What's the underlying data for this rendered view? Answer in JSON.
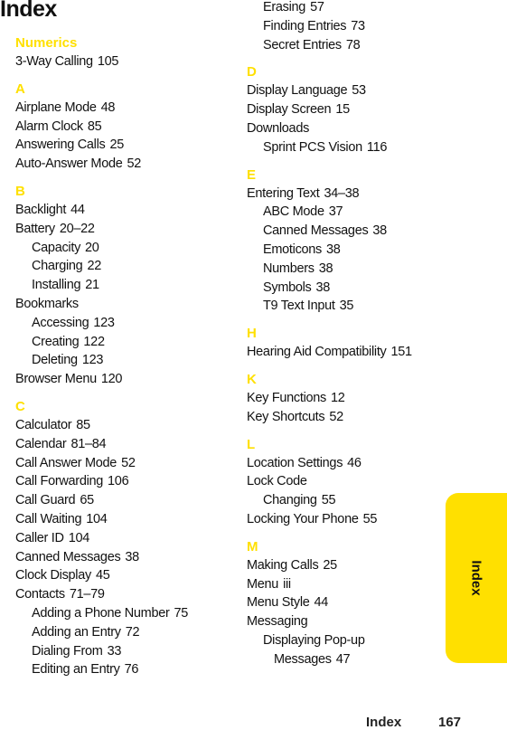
{
  "page": {
    "title": "Index",
    "tab_label": "Index",
    "footer_section": "Index",
    "footer_page": "167",
    "accent_color": "#FFE000"
  },
  "left_column": [
    {
      "letter": "Numerics",
      "entries": [
        {
          "level": 0,
          "text": "3-Way Calling",
          "page": "105"
        }
      ]
    },
    {
      "letter": "A",
      "entries": [
        {
          "level": 0,
          "text": "Airplane Mode",
          "page": "48"
        },
        {
          "level": 0,
          "text": "Alarm Clock",
          "page": "85"
        },
        {
          "level": 0,
          "text": "Answering Calls",
          "page": "25"
        },
        {
          "level": 0,
          "text": "Auto-Answer Mode",
          "page": "52"
        }
      ]
    },
    {
      "letter": "B",
      "entries": [
        {
          "level": 0,
          "text": "Backlight",
          "page": "44"
        },
        {
          "level": 0,
          "text": "Battery",
          "page": "20–22"
        },
        {
          "level": 1,
          "text": "Capacity",
          "page": "20"
        },
        {
          "level": 1,
          "text": "Charging",
          "page": "22"
        },
        {
          "level": 1,
          "text": "Installing",
          "page": "21"
        },
        {
          "level": 0,
          "text": "Bookmarks",
          "page": ""
        },
        {
          "level": 1,
          "text": "Accessing",
          "page": "123"
        },
        {
          "level": 1,
          "text": "Creating",
          "page": "122"
        },
        {
          "level": 1,
          "text": "Deleting",
          "page": "123"
        },
        {
          "level": 0,
          "text": "Browser Menu",
          "page": "120"
        }
      ]
    },
    {
      "letter": "C",
      "entries": [
        {
          "level": 0,
          "text": "Calculator",
          "page": "85"
        },
        {
          "level": 0,
          "text": "Calendar",
          "page": "81–84"
        },
        {
          "level": 0,
          "text": "Call Answer Mode",
          "page": "52"
        },
        {
          "level": 0,
          "text": "Call Forwarding",
          "page": "106"
        },
        {
          "level": 0,
          "text": "Call Guard",
          "page": "65"
        },
        {
          "level": 0,
          "text": "Call Waiting",
          "page": "104"
        },
        {
          "level": 0,
          "text": "Caller ID",
          "page": "104"
        },
        {
          "level": 0,
          "text": "Canned Messages",
          "page": "38"
        },
        {
          "level": 0,
          "text": "Clock Display",
          "page": "45"
        },
        {
          "level": 0,
          "text": "Contacts",
          "page": "71–79"
        },
        {
          "level": 1,
          "text": "Adding a Phone Number",
          "page": "75"
        },
        {
          "level": 1,
          "text": "Adding an Entry",
          "page": "72"
        },
        {
          "level": 1,
          "text": "Dialing From",
          "page": "33"
        },
        {
          "level": 1,
          "text": "Editing an Entry",
          "page": "76"
        }
      ]
    }
  ],
  "right_column": [
    {
      "letter": "",
      "entries": [
        {
          "level": 1,
          "text": "Erasing",
          "page": "57"
        },
        {
          "level": 1,
          "text": "Finding Entries",
          "page": "73"
        },
        {
          "level": 1,
          "text": "Secret Entries",
          "page": "78"
        }
      ]
    },
    {
      "letter": "D",
      "entries": [
        {
          "level": 0,
          "text": "Display Language",
          "page": "53"
        },
        {
          "level": 0,
          "text": "Display Screen",
          "page": "15"
        },
        {
          "level": 0,
          "text": "Downloads",
          "page": ""
        },
        {
          "level": 1,
          "text": "Sprint PCS Vision",
          "page": "116"
        }
      ]
    },
    {
      "letter": "E",
      "entries": [
        {
          "level": 0,
          "text": "Entering Text",
          "page": "34–38"
        },
        {
          "level": 1,
          "text": "ABC Mode",
          "page": "37"
        },
        {
          "level": 1,
          "text": "Canned Messages",
          "page": "38"
        },
        {
          "level": 1,
          "text": "Emoticons",
          "page": "38"
        },
        {
          "level": 1,
          "text": "Numbers",
          "page": "38"
        },
        {
          "level": 1,
          "text": "Symbols",
          "page": "38"
        },
        {
          "level": 1,
          "text": "T9 Text Input",
          "page": "35"
        }
      ]
    },
    {
      "letter": "H",
      "entries": [
        {
          "level": 0,
          "text": "Hearing Aid Compatibility",
          "page": "151"
        }
      ]
    },
    {
      "letter": "K",
      "entries": [
        {
          "level": 0,
          "text": "Key Functions",
          "page": "12"
        },
        {
          "level": 0,
          "text": "Key Shortcuts",
          "page": "52"
        }
      ]
    },
    {
      "letter": "L",
      "entries": [
        {
          "level": 0,
          "text": "Location Settings",
          "page": "46"
        },
        {
          "level": 0,
          "text": "Lock Code",
          "page": ""
        },
        {
          "level": 1,
          "text": "Changing",
          "page": "55"
        },
        {
          "level": 0,
          "text": "Locking Your Phone",
          "page": "55"
        }
      ]
    },
    {
      "letter": "M",
      "entries": [
        {
          "level": 0,
          "text": "Making Calls",
          "page": "25"
        },
        {
          "level": 0,
          "text": "Menu",
          "page": "iii"
        },
        {
          "level": 0,
          "text": "Menu Style",
          "page": "44"
        },
        {
          "level": 0,
          "text": "Messaging",
          "page": ""
        },
        {
          "level": 1,
          "text": "Displaying Pop-up",
          "page": ""
        },
        {
          "level": 2,
          "text": "Messages",
          "page": "47"
        }
      ]
    }
  ]
}
